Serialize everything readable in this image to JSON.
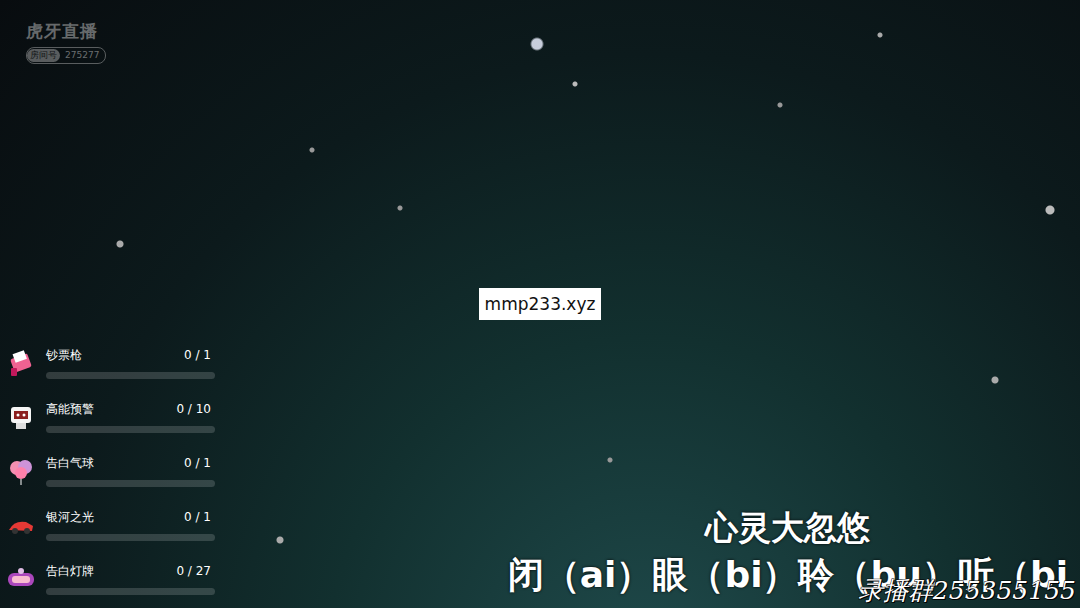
{
  "logo": {
    "text": "虎牙直播",
    "room_label": "房间号",
    "room_number": "275277"
  },
  "url_watermark": "mmp233.xyz",
  "gifts": [
    {
      "name": "钞票枪",
      "count": "0 / 1",
      "level": 0
    },
    {
      "name": "高能预警",
      "count": "0 / 10",
      "level": 0
    },
    {
      "name": "告白气球",
      "count": "0 / 1",
      "level": 0
    },
    {
      "name": "银河之光",
      "count": "0 / 1",
      "level": 0
    },
    {
      "name": "告白灯牌",
      "count": "0 / 27",
      "level": 0
    }
  ],
  "lyrics": {
    "title": "心灵大忽悠",
    "line": "闭（ai）眼（bi）聆（bu）听（bi"
  },
  "group_watermark": "录播群255355155"
}
